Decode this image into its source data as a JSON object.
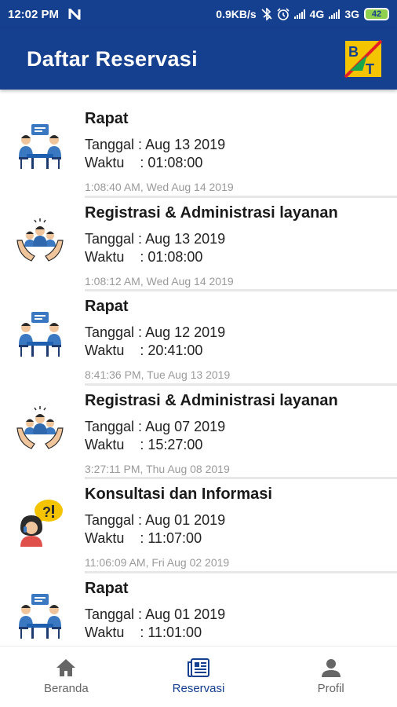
{
  "status_bar": {
    "time": "12:02 PM",
    "speed": "0.9KB/s",
    "network1": "4G",
    "network2": "3G",
    "battery": "42"
  },
  "app_bar": {
    "title": "Daftar Reservasi",
    "logo_text": "BT"
  },
  "reservations": [
    {
      "icon": "meeting-icon",
      "title": "Rapat",
      "date_line": "Tanggal : Aug 13 2019",
      "time_line": "Waktu    : 01:08:00",
      "created": "1:08:40 AM, Wed Aug 14 2019"
    },
    {
      "icon": "registration-icon",
      "title": "Registrasi & Administrasi layanan",
      "date_line": "Tanggal : Aug 13 2019",
      "time_line": "Waktu    : 01:08:00",
      "created": "1:08:12 AM, Wed Aug 14 2019"
    },
    {
      "icon": "meeting-icon",
      "title": "Rapat",
      "date_line": "Tanggal : Aug 12 2019",
      "time_line": "Waktu    : 20:41:00",
      "created": "8:41:36 PM, Tue Aug 13 2019"
    },
    {
      "icon": "registration-icon",
      "title": "Registrasi & Administrasi layanan",
      "date_line": "Tanggal : Aug 07 2019",
      "time_line": "Waktu    : 15:27:00",
      "created": "3:27:11 PM, Thu Aug 08 2019"
    },
    {
      "icon": "consultation-icon",
      "title": "Konsultasi dan Informasi",
      "date_line": "Tanggal : Aug 01 2019",
      "time_line": "Waktu    : 11:07:00",
      "created": "11:06:09 AM, Fri Aug 02 2019"
    },
    {
      "icon": "meeting-icon",
      "title": "Rapat",
      "date_line": "Tanggal : Aug 01 2019",
      "time_line": "Waktu    : 11:01:00",
      "created": ""
    }
  ],
  "bottom_nav": [
    {
      "label": "Beranda",
      "icon": "home-icon",
      "active": false
    },
    {
      "label": "Reservasi",
      "icon": "reservation-icon",
      "active": true
    },
    {
      "label": "Profil",
      "icon": "profile-icon",
      "active": false
    }
  ],
  "colors": {
    "primary": "#153f8f",
    "inactive_nav": "#666666",
    "timestamp": "#9a9a9a"
  }
}
